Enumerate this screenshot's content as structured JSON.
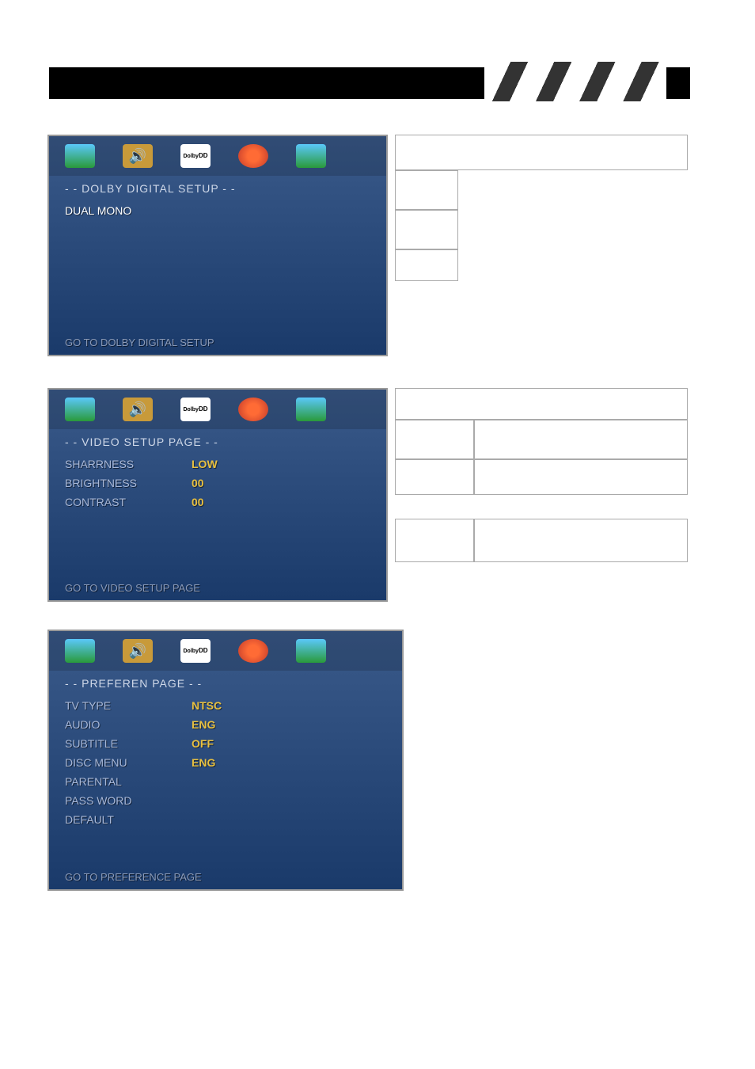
{
  "header": {},
  "menus": {
    "dolby": {
      "title": "- -  DOLBY DIGITAL SETUP  - -",
      "items": [
        {
          "label": "DUAL MONO",
          "value": ""
        }
      ],
      "footer": "GO TO DOLBY DIGITAL SETUP"
    },
    "video": {
      "title": "- -  VIDEO SETUP PAGE    - -",
      "items": [
        {
          "label": "SHARRNESS",
          "value": "LOW"
        },
        {
          "label": "BRIGHTNESS",
          "value": "00"
        },
        {
          "label": "CONTRAST",
          "value": "00"
        }
      ],
      "footer": "GO TO VIDEO  SETUP PAGE"
    },
    "preference": {
      "title": "- -  PREFEREN PAGE  - -",
      "items": [
        {
          "label": "TV TYPE",
          "value": "NTSC"
        },
        {
          "label": "AUDIO",
          "value": "ENG"
        },
        {
          "label": "SUBTITLE",
          "value": "OFF"
        },
        {
          "label": "DISC MENU",
          "value": "ENG"
        },
        {
          "label": "PARENTAL",
          "value": ""
        },
        {
          "label": "PASS WORD",
          "value": ""
        },
        {
          "label": "DEFAULT",
          "value": ""
        }
      ],
      "footer": "GO TO PREFERENCE PAGE"
    }
  },
  "icons": {
    "dolby_label": "DD"
  }
}
